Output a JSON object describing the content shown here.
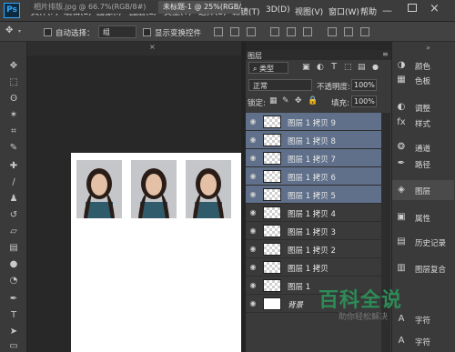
{
  "app": {
    "logo": "Ps"
  },
  "menubar": {
    "items": [
      "文件(F)",
      "编辑(E)",
      "图像(I)",
      "图层(L)",
      "类型(Y)",
      "选择(S)",
      "滤镜(T)",
      "3D(D)",
      "视图(V)",
      "窗口(W)",
      "帮助"
    ]
  },
  "options": {
    "auto_select_label": "自动选择：",
    "auto_select_value": "组",
    "show_transform_label": "显示变换控件"
  },
  "tabs": [
    {
      "label": "相片排版.jpg @ 66.7%(RGB/8#)",
      "close": "×"
    },
    {
      "label": "未标题-1 @ 25%(RGB/8#)",
      "close": "×"
    }
  ],
  "layers_panel": {
    "title": "图层",
    "kind_filter": "类型",
    "blend_mode": "正常",
    "opacity_label": "不透明度:",
    "opacity_value": "100%",
    "lock_label": "锁定:",
    "fill_label": "填充:",
    "fill_value": "100%",
    "layers": [
      {
        "name": "图层 1 拷贝 9",
        "selected": true
      },
      {
        "name": "图层 1 拷贝 8",
        "selected": true
      },
      {
        "name": "图层 1 拷贝 7",
        "selected": true
      },
      {
        "name": "图层 1 拷贝 6",
        "selected": true
      },
      {
        "name": "图层 1 拷贝 5",
        "selected": true
      },
      {
        "name": "图层 1 拷贝 4",
        "selected": false
      },
      {
        "name": "图层 1 拷贝 3",
        "selected": false
      },
      {
        "name": "图层 1 拷贝 2",
        "selected": false
      },
      {
        "name": "图层 1 拷贝",
        "selected": false
      },
      {
        "name": "图层 1",
        "selected": false
      },
      {
        "name": "背景",
        "selected": false
      }
    ]
  },
  "right_dock": [
    {
      "label": "颜色",
      "icon": "color-icon"
    },
    {
      "label": "色板",
      "icon": "swatches-icon"
    },
    {
      "label": "调整",
      "icon": "adjustments-icon"
    },
    {
      "label": "样式",
      "icon": "styles-icon"
    },
    {
      "label": "通道",
      "icon": "channels-icon"
    },
    {
      "label": "路径",
      "icon": "paths-icon"
    },
    {
      "label": "图层",
      "icon": "layers-icon"
    },
    {
      "label": "属性",
      "icon": "properties-icon"
    },
    {
      "label": "历史记录",
      "icon": "history-icon"
    },
    {
      "label": "图层复合",
      "icon": "layer-comps-icon"
    },
    {
      "label": "字符",
      "icon": "character-icon"
    },
    {
      "label": "字符",
      "icon": "character-icon"
    }
  ],
  "watermark": {
    "title": "百科全说",
    "subtitle": "助你轻松解决"
  },
  "colors": {
    "selected_row": "#60708a",
    "ps_blue": "#31a8ff"
  }
}
